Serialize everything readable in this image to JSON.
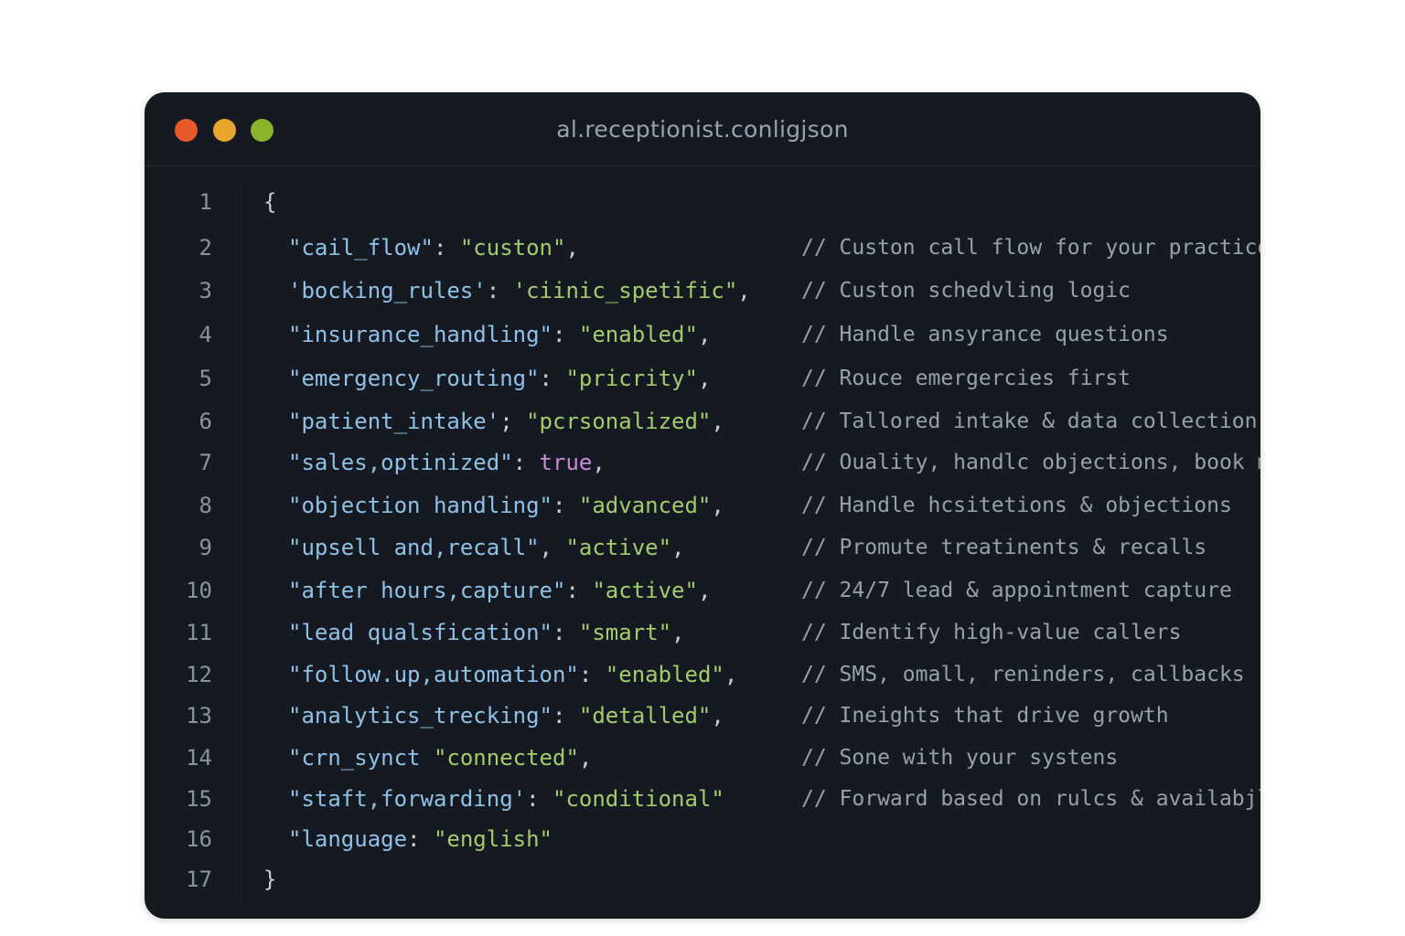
{
  "window": {
    "title": "al.receptionist.conligjson",
    "controls": {
      "close_color": "#e5592a",
      "minimize_color": "#e7a52a",
      "maximize_color": "#8ab52b"
    }
  },
  "editor": {
    "open_brace": "{",
    "close_brace": "}",
    "line_numbers": [
      "1",
      "2",
      "3",
      "4",
      "5",
      "6",
      "7",
      "8",
      "9",
      "10",
      "11",
      "12",
      "13",
      "14",
      "15",
      "16",
      "17"
    ],
    "lines": [
      {
        "key": "\"cail_flow\"",
        "sep": ": ",
        "value": "\"custon\"",
        "value_type": "string",
        "trail": ",",
        "comment": "// Custon call flow for your practico"
      },
      {
        "key": "'bocking_rules'",
        "sep": ": ",
        "value": "'ciinic_spetific\"",
        "value_type": "string",
        "trail": ",",
        "comment": "// Custon schedvling logic"
      },
      {
        "key": "\"insurance_handling\"",
        "sep": ": ",
        "value": "\"enabled\"",
        "value_type": "string",
        "trail": ",",
        "comment": "// Handle ansyrance questions"
      },
      {
        "key": "\"emergency_routing\"",
        "sep": ": ",
        "value": "\"pricrity\"",
        "value_type": "string",
        "trail": ",",
        "comment": "// Rouce emergercies first"
      },
      {
        "key": "\"patient_intake'",
        "sep": "; ",
        "value": "\"pcrsonalized\"",
        "value_type": "string",
        "trail": ",",
        "comment": "// Tallored intake & data collection"
      },
      {
        "key": "\"sales,optinized\"",
        "sep": ": ",
        "value": "true",
        "value_type": "bool",
        "trail": ",",
        "comment": "// Ouality, handlc objections, book more"
      },
      {
        "key": "\"objection handling\"",
        "sep": ": ",
        "value": "\"advanced\"",
        "value_type": "string",
        "trail": ",",
        "comment": "// Handle hcsitetions & objections"
      },
      {
        "key": "\"upsell and,recall\"",
        "sep": ", ",
        "value": "\"active\"",
        "value_type": "string",
        "trail": ",",
        "comment": "// Promute treatinents & recalls"
      },
      {
        "key": "\"after hours,capture\"",
        "sep": ": ",
        "value": "\"active\"",
        "value_type": "string",
        "trail": ",",
        "comment": "// 24/7 lead & appointment capture"
      },
      {
        "key": "\"lead qualsfication\"",
        "sep": ": ",
        "value": "\"smart\"",
        "value_type": "string",
        "trail": ",",
        "comment": "// Identify high-value callers"
      },
      {
        "key": "\"follow.up,automation\"",
        "sep": ": ",
        "value": "\"enabled\"",
        "value_type": "string",
        "trail": ",",
        "comment": "// SMS, omall, reninders, callbacks"
      },
      {
        "key": "\"analytics_trecking\"",
        "sep": ": ",
        "value": "\"detalled\"",
        "value_type": "string",
        "trail": ",",
        "comment": "// Ineights that drive growth"
      },
      {
        "key": "\"crn_synct",
        "sep": " ",
        "value": "\"connected\"",
        "value_type": "string",
        "trail": ",",
        "comment": "// Sone with your systens"
      },
      {
        "key": "\"staft,forwarding'",
        "sep": ": ",
        "value": "\"conditional\"",
        "value_type": "string",
        "trail": "",
        "comment": "// Forward based on rulcs & availabjllty"
      },
      {
        "key": "\"language",
        "sep": ": ",
        "value": "\"english\"",
        "value_type": "string",
        "trail": "",
        "comment": ""
      }
    ]
  }
}
